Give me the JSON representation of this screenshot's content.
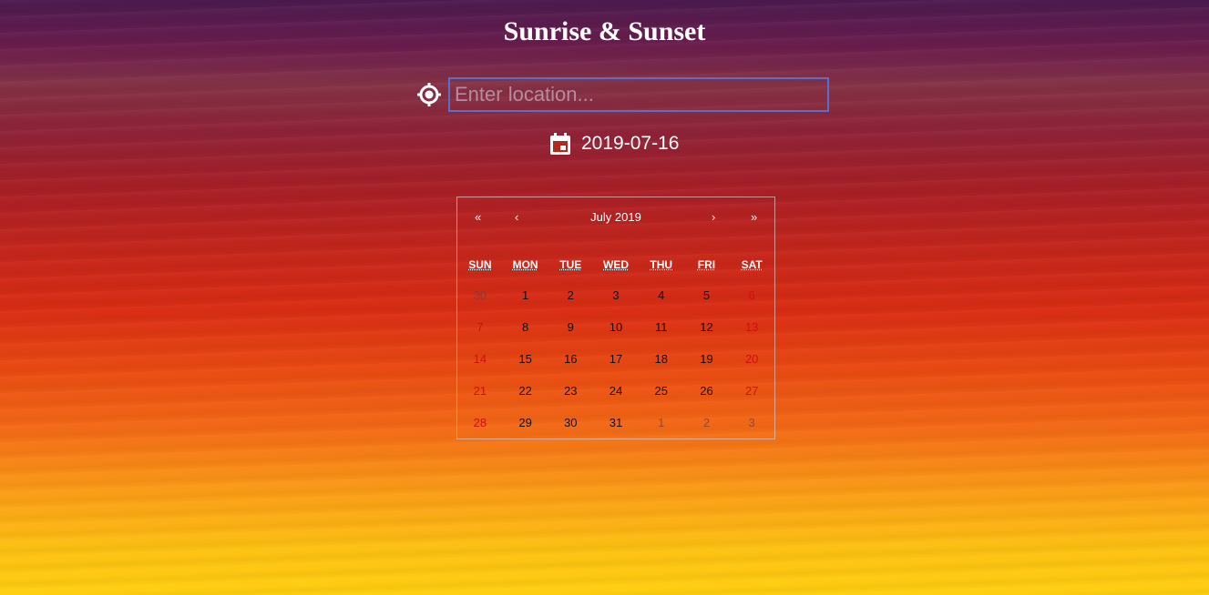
{
  "title": "Sunrise & Sunset",
  "location": {
    "placeholder": "Enter location...",
    "value": "",
    "icon": "locate-icon"
  },
  "date": {
    "value": "2019-07-16",
    "icon": "calendar-icon"
  },
  "calendar": {
    "month_label": "July 2019",
    "nav": {
      "prev_year": "«",
      "prev_month": "‹",
      "next_month": "›",
      "next_year": "»"
    },
    "weekdays": [
      "SUN",
      "MON",
      "TUE",
      "WED",
      "THU",
      "FRI",
      "SAT"
    ],
    "weeks": [
      [
        "30",
        "1",
        "2",
        "3",
        "4",
        "5",
        "6"
      ],
      [
        "7",
        "8",
        "9",
        "10",
        "11",
        "12",
        "13"
      ],
      [
        "14",
        "15",
        "16",
        "17",
        "18",
        "19",
        "20"
      ],
      [
        "21",
        "22",
        "23",
        "24",
        "25",
        "26",
        "27"
      ],
      [
        "28",
        "29",
        "30",
        "31",
        "1",
        "2",
        "3"
      ]
    ],
    "colors": {
      "weekend": "#d01010",
      "weekday": "#111111",
      "other_month": "#8a4a4a"
    }
  }
}
